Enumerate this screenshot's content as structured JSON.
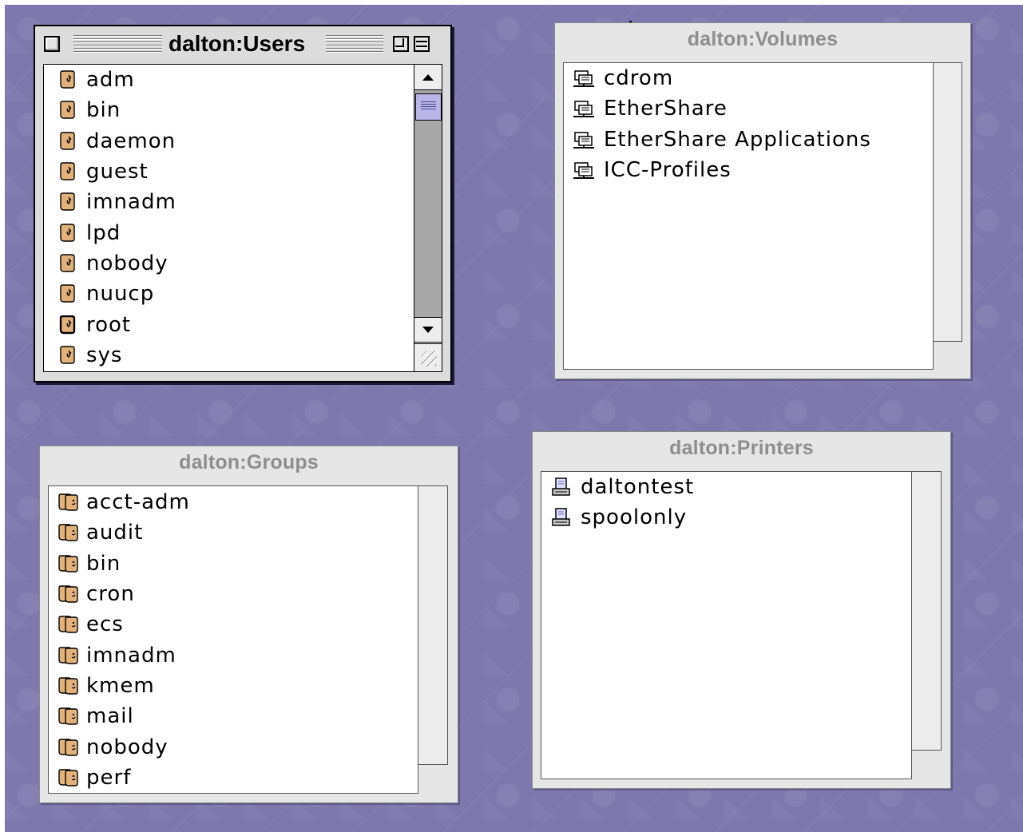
{
  "windows": {
    "users": {
      "title": "dalton:Users",
      "items": [
        "adm",
        "bin",
        "daemon",
        "guest",
        "imnadm",
        "lpd",
        "nobody",
        "nuucp",
        "root",
        "sys"
      ],
      "selected": "root"
    },
    "volumes": {
      "title": "dalton:Volumes",
      "items": [
        "cdrom",
        "EtherShare",
        "EtherShare Applications",
        "ICC-Profiles"
      ]
    },
    "groups": {
      "title": "dalton:Groups",
      "items": [
        "acct-adm",
        "audit",
        "bin",
        "cron",
        "ecs",
        "imnadm",
        "kmem",
        "mail",
        "nobody",
        "perf"
      ]
    },
    "printers": {
      "title": "dalton:Printers",
      "items": [
        "daltontest",
        "spoolonly"
      ]
    }
  },
  "icons": {
    "user": "user-icon",
    "group": "group-icon",
    "volume": "network-volume-icon",
    "printer": "printer-icon"
  },
  "colors": {
    "desktop": "#7e78ae",
    "window_frame": "#e6e6e6",
    "scroll_thumb": "#b9b5e8",
    "user_icon": "#e3b27a"
  }
}
